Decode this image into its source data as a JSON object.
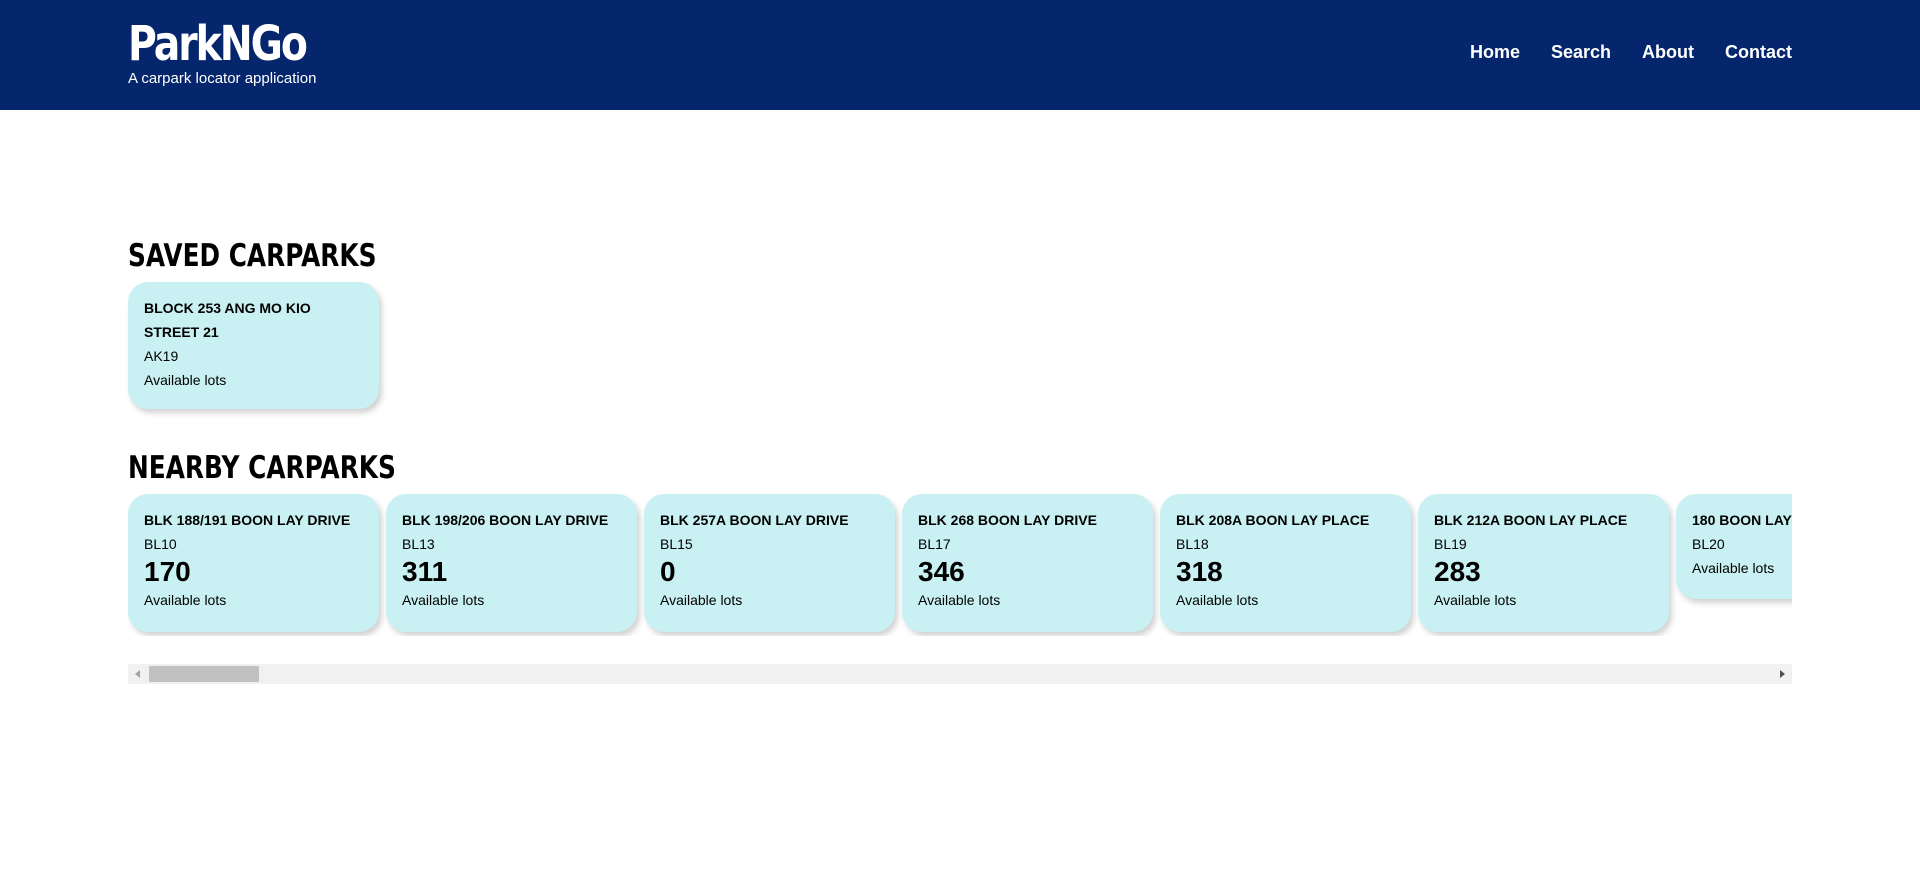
{
  "header": {
    "brand_title": "ParkNGo",
    "brand_subtitle": "A carpark locator application",
    "nav": [
      "Home",
      "Search",
      "About",
      "Contact"
    ]
  },
  "colors": {
    "header_bg": "#05266d",
    "card_bg": "#c9f0f2",
    "text": "#000000"
  },
  "saved": {
    "title": "SAVED CARPARKS",
    "carparks": [
      {
        "name": "BLOCK 253 ANG MO KIO STREET 21",
        "code": "AK19",
        "lots": "",
        "lots_label": "Available lots"
      }
    ]
  },
  "nearby": {
    "title": "NEARBY CARPARKS",
    "carparks": [
      {
        "name": "BLK 188/191 BOON LAY DRIVE",
        "code": "BL10",
        "lots": "170",
        "lots_label": "Available lots"
      },
      {
        "name": "BLK 198/206 BOON LAY DRIVE",
        "code": "BL13",
        "lots": "311",
        "lots_label": "Available lots"
      },
      {
        "name": "BLK 257A BOON LAY DRIVE",
        "code": "BL15",
        "lots": "0",
        "lots_label": "Available lots"
      },
      {
        "name": "BLK 268 BOON LAY DRIVE",
        "code": "BL17",
        "lots": "346",
        "lots_label": "Available lots"
      },
      {
        "name": "BLK 208A BOON LAY PLACE",
        "code": "BL18",
        "lots": "318",
        "lots_label": "Available lots"
      },
      {
        "name": "BLK 212A BOON LAY PLACE",
        "code": "BL19",
        "lots": "283",
        "lots_label": "Available lots"
      },
      {
        "name": "180 BOON LAY",
        "code": "BL20",
        "lots": "",
        "lots_label": "Available lots"
      }
    ]
  },
  "scrollbar": {
    "position_fraction": 0.0
  }
}
